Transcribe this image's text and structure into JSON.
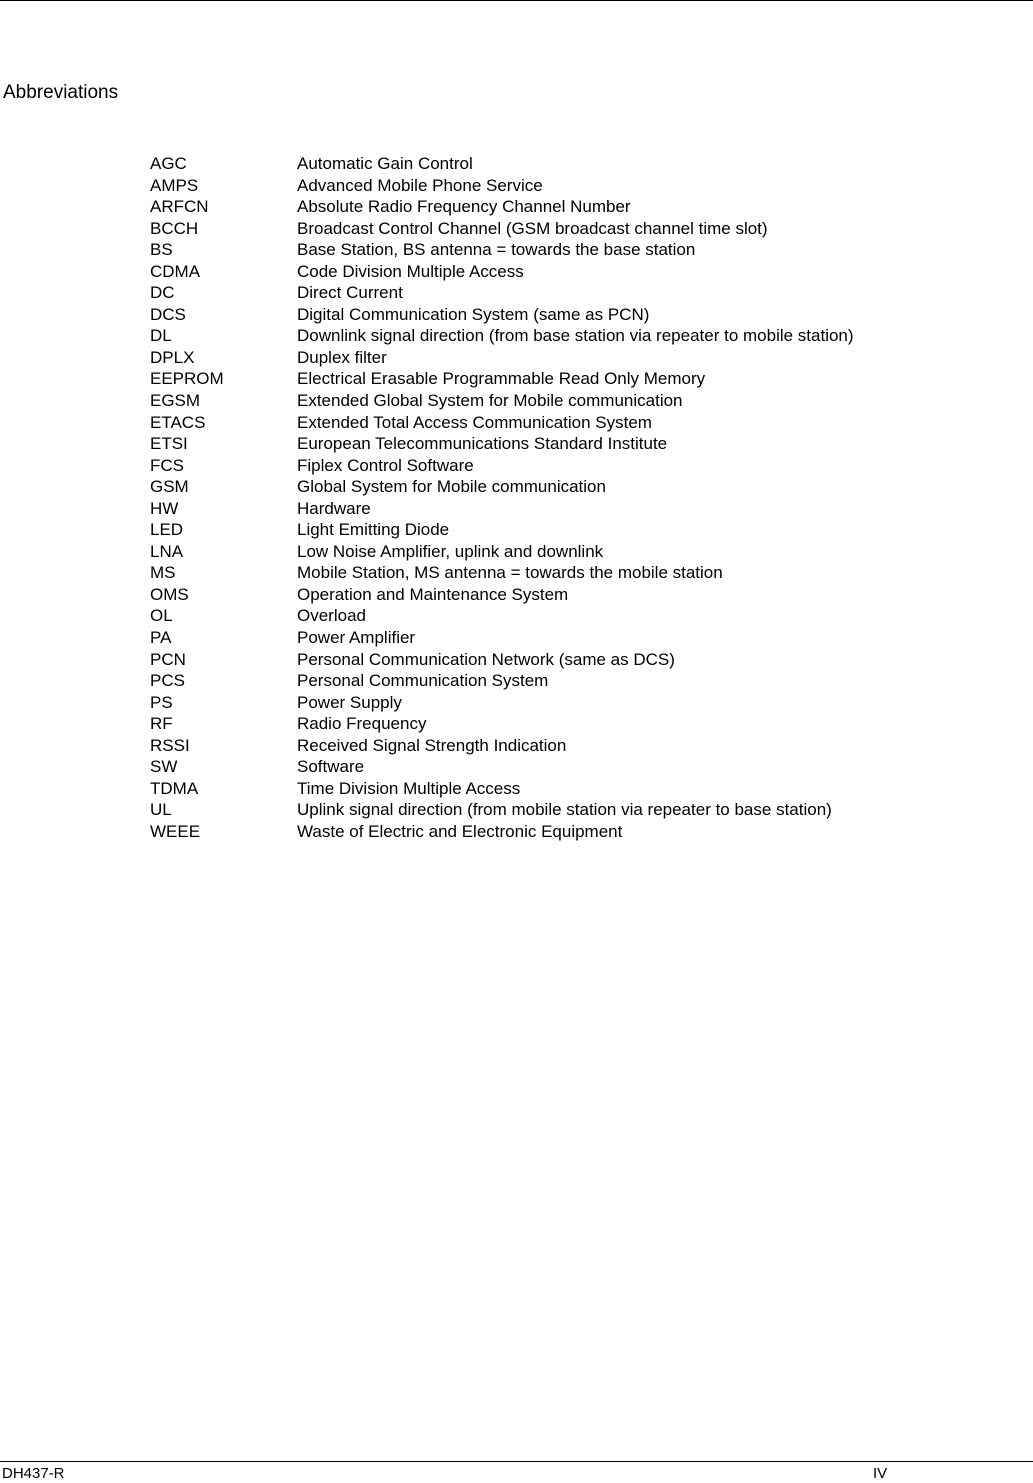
{
  "page": {
    "title": "Abbreviations",
    "footer": {
      "document_id": "DH437-R",
      "page_number": "IV"
    }
  },
  "abbreviations": [
    {
      "abbr": "AGC",
      "definition": "Automatic Gain Control"
    },
    {
      "abbr": "AMPS",
      "definition": "Advanced Mobile Phone Service"
    },
    {
      "abbr": "ARFCN",
      "definition": "Absolute Radio Frequency Channel Number"
    },
    {
      "abbr": "BCCH",
      "definition": "Broadcast Control Channel (GSM broadcast channel time slot)"
    },
    {
      "abbr": "BS",
      "definition": "Base Station, BS antenna = towards the base station"
    },
    {
      "abbr": "CDMA",
      "definition": "Code Division Multiple Access"
    },
    {
      "abbr": "DC",
      "definition": "Direct Current"
    },
    {
      "abbr": "DCS",
      "definition": "Digital Communication System (same as PCN)"
    },
    {
      "abbr": "DL",
      "definition": "Downlink signal direction (from base station via repeater to mobile station)"
    },
    {
      "abbr": "DPLX",
      "definition": "Duplex filter"
    },
    {
      "abbr": "EEPROM",
      "definition": "Electrical Erasable Programmable Read Only Memory"
    },
    {
      "abbr": "EGSM",
      "definition": "Extended Global System for Mobile communication"
    },
    {
      "abbr": "ETACS",
      "definition": "Extended Total Access Communication System"
    },
    {
      "abbr": "ETSI",
      "definition": "European Telecommunications Standard Institute"
    },
    {
      "abbr": "FCS",
      "definition": "Fiplex Control Software"
    },
    {
      "abbr": "GSM",
      "definition": "Global System for Mobile communication"
    },
    {
      "abbr": "HW",
      "definition": "Hardware"
    },
    {
      "abbr": "LED",
      "definition": "Light Emitting Diode"
    },
    {
      "abbr": "LNA",
      "definition": "Low Noise Amplifier, uplink and downlink"
    },
    {
      "abbr": "MS",
      "definition": "Mobile Station, MS antenna = towards the mobile station"
    },
    {
      "abbr": "OMS",
      "definition": "Operation and Maintenance System"
    },
    {
      "abbr": "OL",
      "definition": "Overload"
    },
    {
      "abbr": "PA",
      "definition": "Power Amplifier"
    },
    {
      "abbr": "PCN",
      "definition": "Personal Communication Network (same as DCS)"
    },
    {
      "abbr": "PCS",
      "definition": "Personal Communication System"
    },
    {
      "abbr": "PS",
      "definition": "Power Supply"
    },
    {
      "abbr": "RF",
      "definition": "Radio Frequency"
    },
    {
      "abbr": "RSSI",
      "definition": "Received Signal Strength Indication"
    },
    {
      "abbr": "SW",
      "definition": "Software"
    },
    {
      "abbr": "TDMA",
      "definition": "Time Division Multiple Access"
    },
    {
      "abbr": "UL",
      "definition": "Uplink signal direction (from mobile station via repeater to base station)"
    },
    {
      "abbr": "WEEE",
      "definition": "Waste of Electric and Electronic Equipment"
    }
  ]
}
